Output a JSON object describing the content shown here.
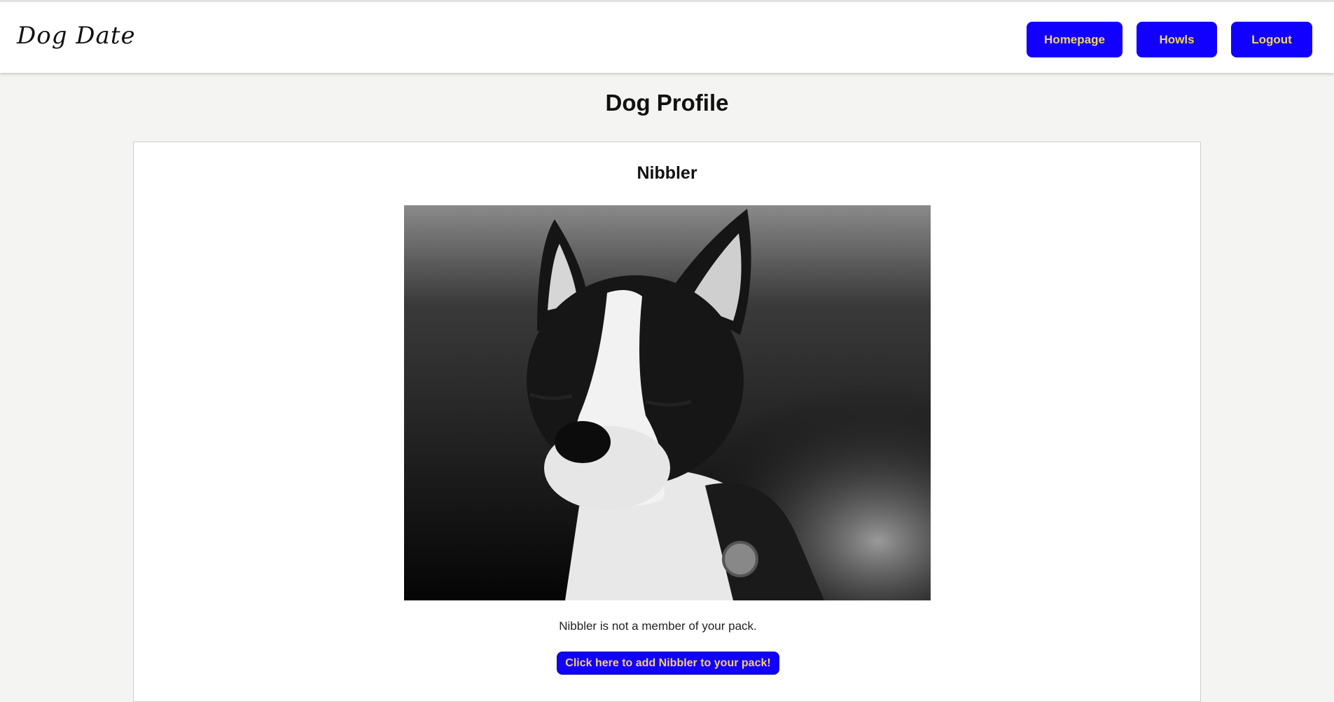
{
  "header": {
    "logo": "Dog Date",
    "nav": {
      "homepage": "Homepage",
      "howls": "Howls",
      "logout": "Logout"
    }
  },
  "page": {
    "title": "Dog Profile"
  },
  "profile": {
    "name": "Nibbler",
    "status": "Nibbler is not a member of your pack.",
    "add_button": "Click here to add Nibbler to your pack!"
  },
  "colors": {
    "button_bg": "#1200ff",
    "button_text": "#f2d75a",
    "page_bg": "#f4f4f2"
  }
}
